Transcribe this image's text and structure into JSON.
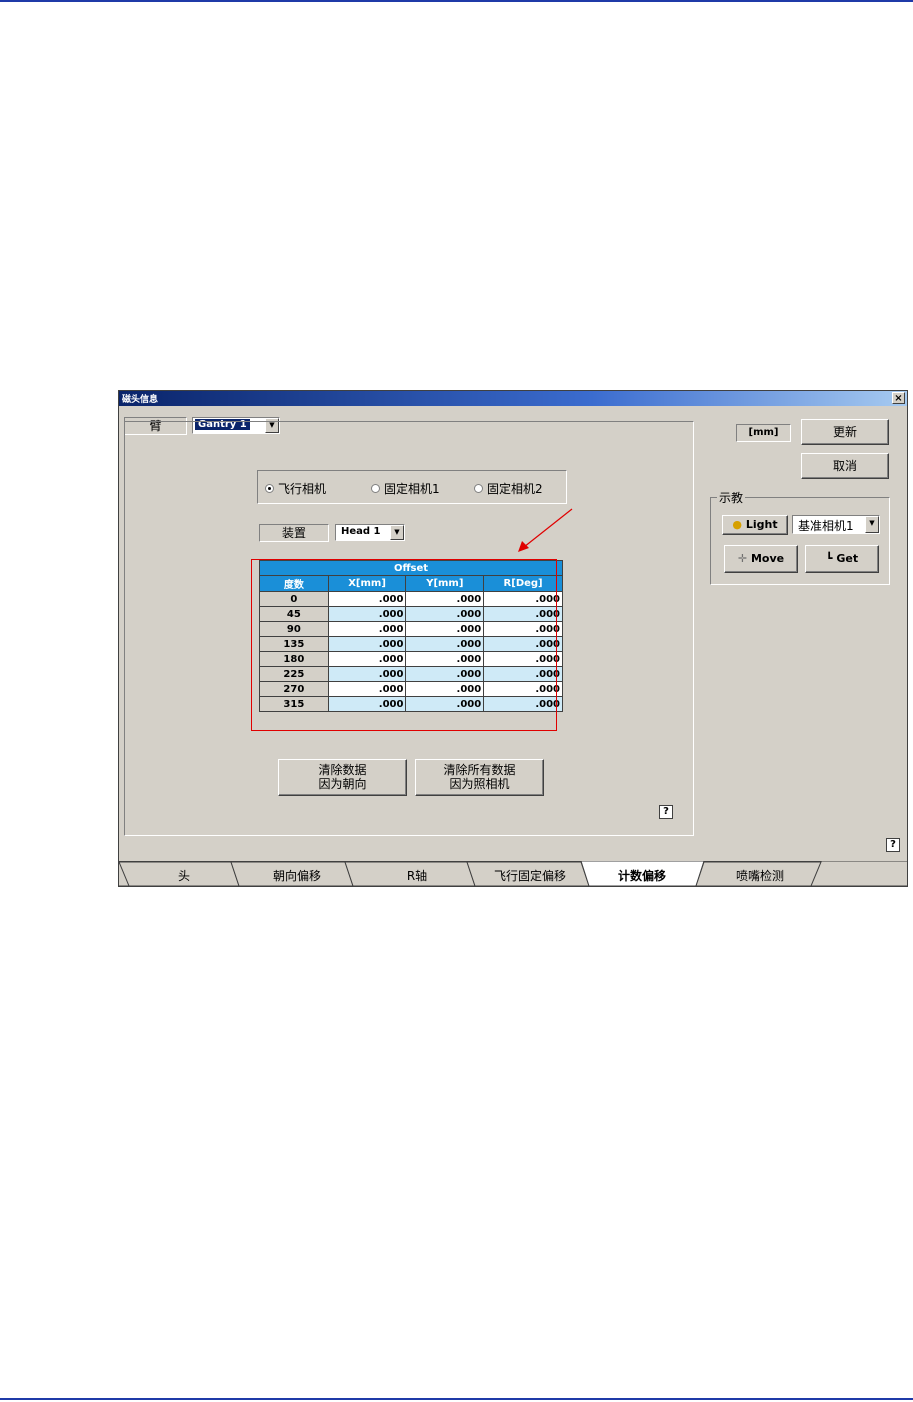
{
  "window": {
    "title": "磁头信息",
    "close": "×"
  },
  "header": {
    "gantry_label": "臂",
    "gantry_value": "Gantry 1"
  },
  "units": "[mm]",
  "buttons": {
    "update": "更新",
    "cancel": "取消",
    "clear_orient": [
      "清除数据",
      "因为朝向"
    ],
    "clear_all": [
      "清除所有数据",
      "因为照相机"
    ]
  },
  "camera_options": [
    {
      "label": "飞行相机",
      "selected": true
    },
    {
      "label": "固定相机1",
      "selected": false
    },
    {
      "label": "固定相机2",
      "selected": false
    }
  ],
  "device": {
    "label": "装置",
    "value": "Head 1"
  },
  "offset_table": {
    "title": "Offset",
    "columns": [
      "度数",
      "X[mm]",
      "Y[mm]",
      "R[Deg]"
    ],
    "rows": [
      [
        "0",
        ".000",
        ".000",
        ".000"
      ],
      [
        "45",
        ".000",
        ".000",
        ".000"
      ],
      [
        "90",
        ".000",
        ".000",
        ".000"
      ],
      [
        "135",
        ".000",
        ".000",
        ".000"
      ],
      [
        "180",
        ".000",
        ".000",
        ".000"
      ],
      [
        "225",
        ".000",
        ".000",
        ".000"
      ],
      [
        "270",
        ".000",
        ".000",
        ".000"
      ],
      [
        "315",
        ".000",
        ".000",
        ".000"
      ]
    ]
  },
  "teach": {
    "label": "示教",
    "light": "Light",
    "camera_value": "基准相机1",
    "move": "Move",
    "get": "Get"
  },
  "help": "?",
  "tabs": [
    {
      "label": "头",
      "active": false
    },
    {
      "label": "朝向偏移",
      "active": false
    },
    {
      "label": "R轴",
      "active": false
    },
    {
      "label": "飞行固定偏移",
      "active": false
    },
    {
      "label": "计数偏移",
      "active": true
    },
    {
      "label": "喷嘴检测",
      "active": false
    }
  ],
  "colors": {
    "highlight": "#e00000",
    "table_header": "#1a8fd8",
    "row_alt": "#cfeaf7"
  }
}
